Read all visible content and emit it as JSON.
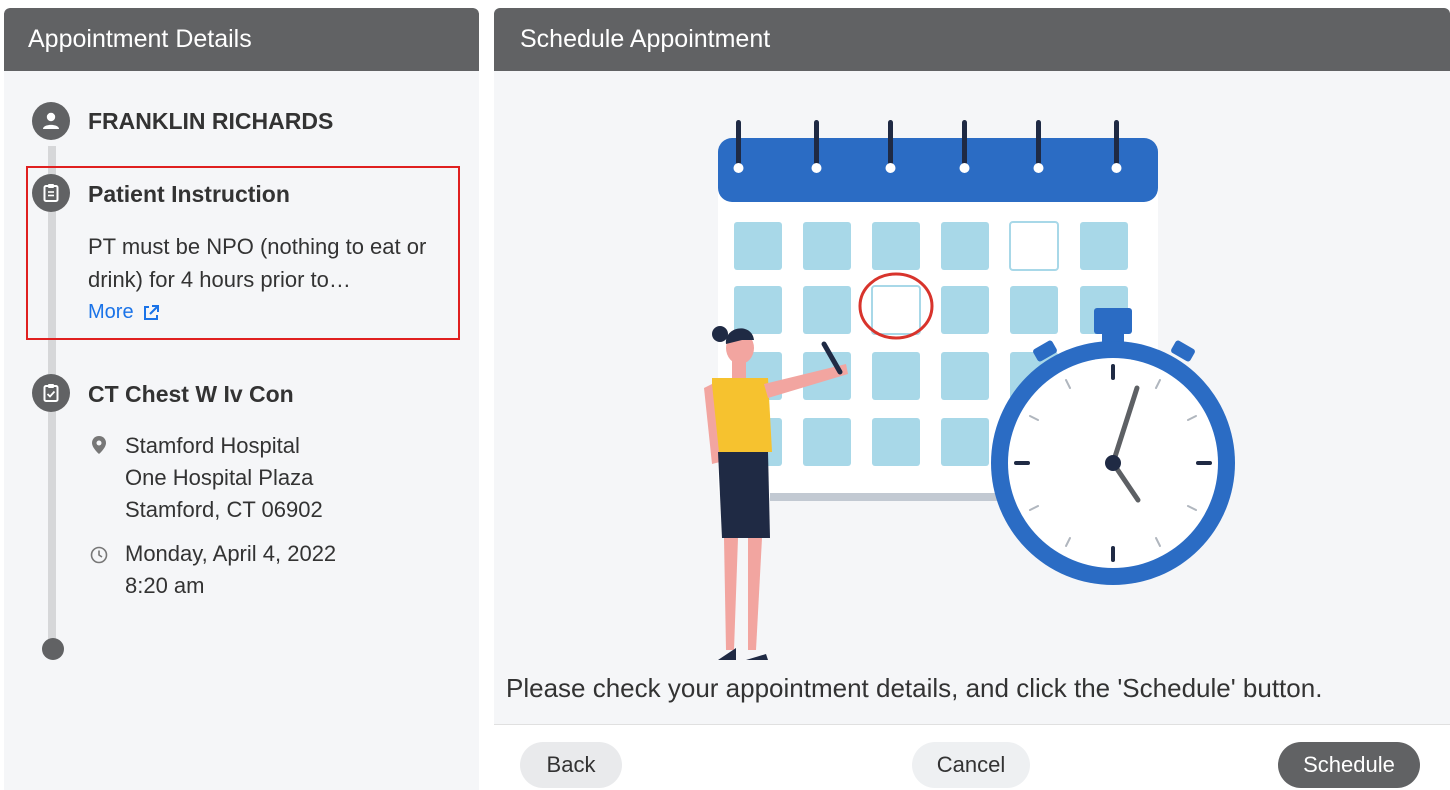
{
  "left": {
    "title": "Appointment Details",
    "patient_name": "FRANKLIN RICHARDS",
    "instruction": {
      "title": "Patient Instruction",
      "body": "PT must be NPO (nothing to eat or drink) for 4 hours prior to…",
      "more_label": "More"
    },
    "procedure": {
      "title": "CT Chest W Iv Con",
      "location_lines": [
        "Stamford Hospital",
        "One Hospital Plaza",
        "Stamford, CT 06902"
      ],
      "date": "Monday, April 4, 2022",
      "time": "8:20 am"
    }
  },
  "right": {
    "title": "Schedule Appointment",
    "message": "Please check your appointment details, and click the 'Schedule' button."
  },
  "footer": {
    "back_label": "Back",
    "cancel_label": "Cancel",
    "schedule_label": "Schedule"
  },
  "colors": {
    "header_bg": "#616264",
    "highlight_border": "#e02020",
    "link": "#1a73e8",
    "calendar_blue": "#2b6cc4",
    "calendar_cell": "#a8d8e8"
  },
  "icons": {
    "patient": "person-icon",
    "instruction": "clipboard-icon",
    "procedure": "clipboard-check-icon",
    "location": "location-pin-icon",
    "time": "clock-icon",
    "more": "external-link-icon"
  }
}
